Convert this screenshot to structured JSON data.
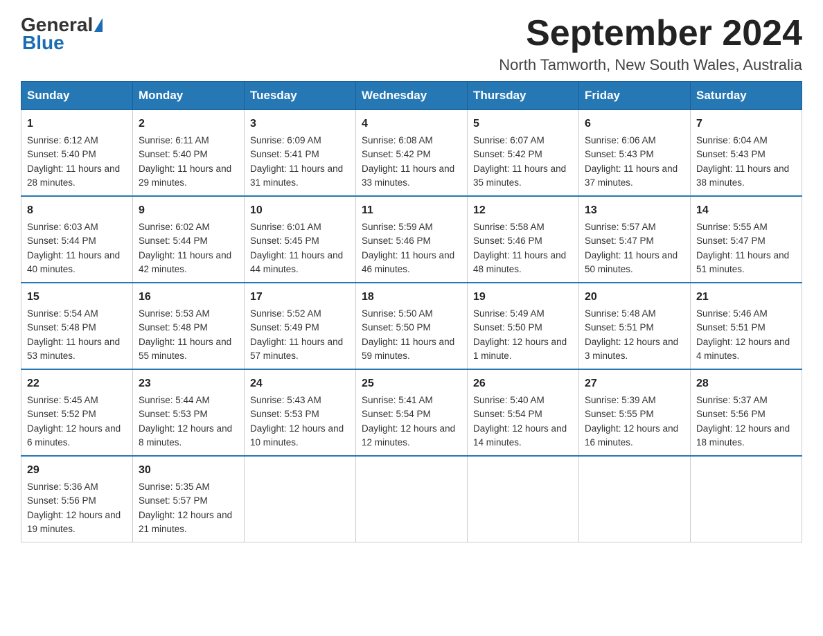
{
  "header": {
    "logo_general": "General",
    "logo_blue": "Blue",
    "month_title": "September 2024",
    "location": "North Tamworth, New South Wales, Australia"
  },
  "weekdays": [
    "Sunday",
    "Monday",
    "Tuesday",
    "Wednesday",
    "Thursday",
    "Friday",
    "Saturday"
  ],
  "weeks": [
    [
      {
        "day": "1",
        "sunrise": "6:12 AM",
        "sunset": "5:40 PM",
        "daylight": "11 hours and 28 minutes."
      },
      {
        "day": "2",
        "sunrise": "6:11 AM",
        "sunset": "5:40 PM",
        "daylight": "11 hours and 29 minutes."
      },
      {
        "day": "3",
        "sunrise": "6:09 AM",
        "sunset": "5:41 PM",
        "daylight": "11 hours and 31 minutes."
      },
      {
        "day": "4",
        "sunrise": "6:08 AM",
        "sunset": "5:42 PM",
        "daylight": "11 hours and 33 minutes."
      },
      {
        "day": "5",
        "sunrise": "6:07 AM",
        "sunset": "5:42 PM",
        "daylight": "11 hours and 35 minutes."
      },
      {
        "day": "6",
        "sunrise": "6:06 AM",
        "sunset": "5:43 PM",
        "daylight": "11 hours and 37 minutes."
      },
      {
        "day": "7",
        "sunrise": "6:04 AM",
        "sunset": "5:43 PM",
        "daylight": "11 hours and 38 minutes."
      }
    ],
    [
      {
        "day": "8",
        "sunrise": "6:03 AM",
        "sunset": "5:44 PM",
        "daylight": "11 hours and 40 minutes."
      },
      {
        "day": "9",
        "sunrise": "6:02 AM",
        "sunset": "5:44 PM",
        "daylight": "11 hours and 42 minutes."
      },
      {
        "day": "10",
        "sunrise": "6:01 AM",
        "sunset": "5:45 PM",
        "daylight": "11 hours and 44 minutes."
      },
      {
        "day": "11",
        "sunrise": "5:59 AM",
        "sunset": "5:46 PM",
        "daylight": "11 hours and 46 minutes."
      },
      {
        "day": "12",
        "sunrise": "5:58 AM",
        "sunset": "5:46 PM",
        "daylight": "11 hours and 48 minutes."
      },
      {
        "day": "13",
        "sunrise": "5:57 AM",
        "sunset": "5:47 PM",
        "daylight": "11 hours and 50 minutes."
      },
      {
        "day": "14",
        "sunrise": "5:55 AM",
        "sunset": "5:47 PM",
        "daylight": "11 hours and 51 minutes."
      }
    ],
    [
      {
        "day": "15",
        "sunrise": "5:54 AM",
        "sunset": "5:48 PM",
        "daylight": "11 hours and 53 minutes."
      },
      {
        "day": "16",
        "sunrise": "5:53 AM",
        "sunset": "5:48 PM",
        "daylight": "11 hours and 55 minutes."
      },
      {
        "day": "17",
        "sunrise": "5:52 AM",
        "sunset": "5:49 PM",
        "daylight": "11 hours and 57 minutes."
      },
      {
        "day": "18",
        "sunrise": "5:50 AM",
        "sunset": "5:50 PM",
        "daylight": "11 hours and 59 minutes."
      },
      {
        "day": "19",
        "sunrise": "5:49 AM",
        "sunset": "5:50 PM",
        "daylight": "12 hours and 1 minute."
      },
      {
        "day": "20",
        "sunrise": "5:48 AM",
        "sunset": "5:51 PM",
        "daylight": "12 hours and 3 minutes."
      },
      {
        "day": "21",
        "sunrise": "5:46 AM",
        "sunset": "5:51 PM",
        "daylight": "12 hours and 4 minutes."
      }
    ],
    [
      {
        "day": "22",
        "sunrise": "5:45 AM",
        "sunset": "5:52 PM",
        "daylight": "12 hours and 6 minutes."
      },
      {
        "day": "23",
        "sunrise": "5:44 AM",
        "sunset": "5:53 PM",
        "daylight": "12 hours and 8 minutes."
      },
      {
        "day": "24",
        "sunrise": "5:43 AM",
        "sunset": "5:53 PM",
        "daylight": "12 hours and 10 minutes."
      },
      {
        "day": "25",
        "sunrise": "5:41 AM",
        "sunset": "5:54 PM",
        "daylight": "12 hours and 12 minutes."
      },
      {
        "day": "26",
        "sunrise": "5:40 AM",
        "sunset": "5:54 PM",
        "daylight": "12 hours and 14 minutes."
      },
      {
        "day": "27",
        "sunrise": "5:39 AM",
        "sunset": "5:55 PM",
        "daylight": "12 hours and 16 minutes."
      },
      {
        "day": "28",
        "sunrise": "5:37 AM",
        "sunset": "5:56 PM",
        "daylight": "12 hours and 18 minutes."
      }
    ],
    [
      {
        "day": "29",
        "sunrise": "5:36 AM",
        "sunset": "5:56 PM",
        "daylight": "12 hours and 19 minutes."
      },
      {
        "day": "30",
        "sunrise": "5:35 AM",
        "sunset": "5:57 PM",
        "daylight": "12 hours and 21 minutes."
      },
      null,
      null,
      null,
      null,
      null
    ]
  ],
  "labels": {
    "sunrise": "Sunrise:",
    "sunset": "Sunset:",
    "daylight": "Daylight:"
  }
}
